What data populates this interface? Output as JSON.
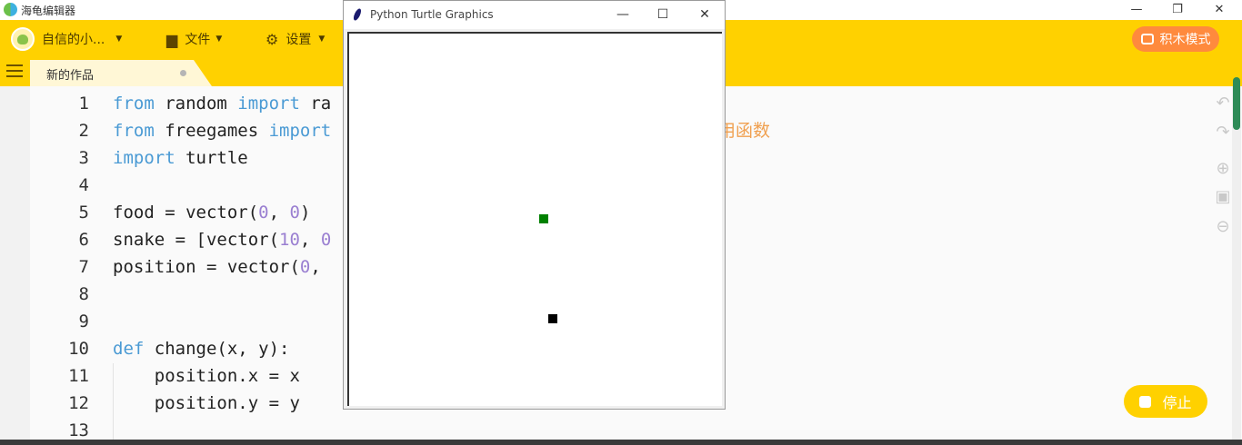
{
  "app": {
    "title": "海龟编辑器"
  },
  "window_controls": {
    "minimize": "—",
    "restore": "❐",
    "close": "✕"
  },
  "header": {
    "user_name": "自信的小...",
    "file_menu": "文件",
    "settings_menu": "设置",
    "blocks_mode": "积木模式",
    "tab_label": "新的作品"
  },
  "editor": {
    "lines": [
      {
        "n": "1"
      },
      {
        "n": "2"
      },
      {
        "n": "3"
      },
      {
        "n": "4"
      },
      {
        "n": "5"
      },
      {
        "n": "6"
      },
      {
        "n": "7"
      },
      {
        "n": "8"
      },
      {
        "n": "9"
      },
      {
        "n": "10"
      },
      {
        "n": "11"
      },
      {
        "n": "12"
      },
      {
        "n": "13"
      }
    ],
    "code": {
      "l1_kw1": "from",
      "l1_mod": " random ",
      "l1_kw2": "import",
      "l1_rest": " ra",
      "l2_kw1": "from",
      "l2_mod": " freegames ",
      "l2_kw2": "import",
      "l2_comment": "用函数",
      "l3_kw": "import",
      "l3_rest": " turtle",
      "l5_a": "food = vector(",
      "l5_n1": "0",
      "l5_b": ", ",
      "l5_n2": "0",
      "l5_c": ")",
      "l6_a": "snake = [vector(",
      "l6_n1": "10",
      "l6_b": ", ",
      "l6_n2": "0",
      "l7_a": "position = vector(",
      "l7_n1": "0",
      "l7_b": ",",
      "l10_kw": "def",
      "l10_rest": " change(x, y):",
      "l11": "    position.x = x",
      "l12": "    position.y = y"
    }
  },
  "stop_button": {
    "label": "停止"
  },
  "turtle_window": {
    "title": "Python Turtle Graphics",
    "minimize": "—",
    "maximize": "☐",
    "close": "✕"
  },
  "colors": {
    "header": "#ffd100",
    "blocks_button": "#ff8a3d",
    "food": "#008000",
    "snake": "#000000"
  }
}
